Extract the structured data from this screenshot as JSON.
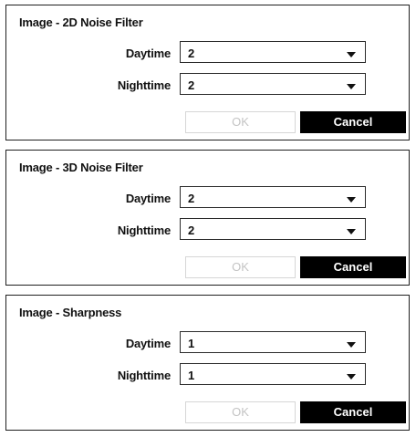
{
  "dialogs": [
    {
      "title": "Image - 2D Noise Filter",
      "daytime_label": "Daytime",
      "daytime_value": "2",
      "nighttime_label": "Nighttime",
      "nighttime_value": "2",
      "ok_label": "OK",
      "ok_enabled": false,
      "cancel_label": "Cancel"
    },
    {
      "title": "Image - 3D Noise Filter",
      "daytime_label": "Daytime",
      "daytime_value": "2",
      "nighttime_label": "Nighttime",
      "nighttime_value": "2",
      "ok_label": "OK",
      "ok_enabled": false,
      "cancel_label": "Cancel"
    },
    {
      "title": "Image - Sharpness",
      "daytime_label": "Daytime",
      "daytime_value": "1",
      "nighttime_label": "Nighttime",
      "nighttime_value": "1",
      "ok_label": "OK",
      "ok_enabled": false,
      "cancel_label": "Cancel"
    }
  ],
  "icons": {
    "dropdown": "chevron-down-icon"
  },
  "colors": {
    "border": "#1f1f1f",
    "text": "#111111",
    "ok_disabled_text": "#c4c4c4",
    "ok_disabled_border": "#d6d6d6",
    "cancel_bg": "#000000",
    "cancel_text": "#ffffff"
  }
}
